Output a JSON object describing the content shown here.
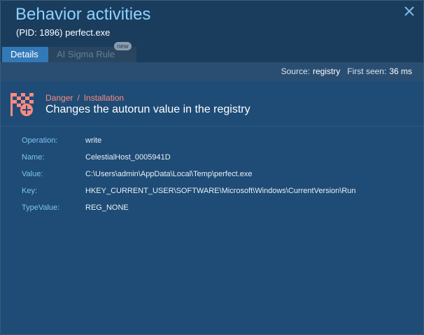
{
  "window": {
    "title": "Behavior activities",
    "subtitle": "(PID: 1896) perfect.exe"
  },
  "tabs": [
    {
      "label": "Details",
      "active": true
    },
    {
      "label": "AI Sigma Rule",
      "active": false,
      "badge": "new"
    }
  ],
  "info": {
    "source_label": "Source:",
    "source_value": "registry",
    "first_seen_label": "First seen:",
    "first_seen_value": "36 ms"
  },
  "event": {
    "severity": "Danger",
    "separator": "/",
    "category": "Installation",
    "title": "Changes the autorun value in the registry",
    "icon": "danger-flag-icon",
    "severity_color": "#ff8a80"
  },
  "details": [
    {
      "key": "Operation:",
      "value": "write"
    },
    {
      "key": "Name:",
      "value": "CelestialHost_0005941D"
    },
    {
      "key": "Value:",
      "value": "C:\\Users\\admin\\AppData\\Local\\Temp\\perfect.exe"
    },
    {
      "key": "Key:",
      "value": "HKEY_CURRENT_USER\\SOFTWARE\\Microsoft\\Windows\\CurrentVersion\\Run"
    },
    {
      "key": "TypeValue:",
      "value": "REG_NONE"
    }
  ],
  "colors": {
    "accent": "#3279b8",
    "title": "#8fd2ff",
    "key": "#7fc3f0"
  }
}
